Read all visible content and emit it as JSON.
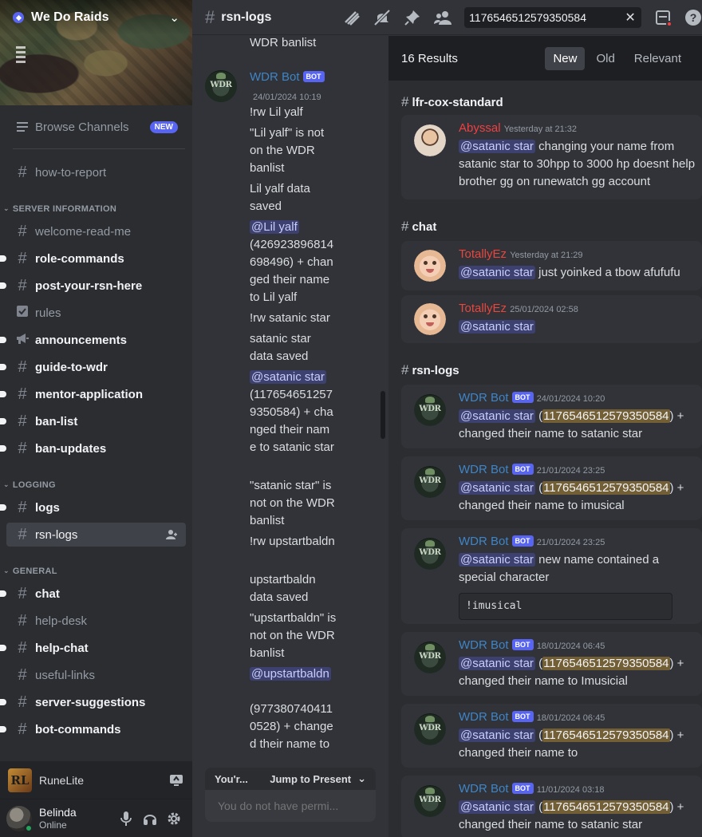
{
  "server": {
    "name": "We Do Raids"
  },
  "sidebar": {
    "browse_label": "Browse Channels",
    "new_badge": "NEW",
    "channels_top": [
      {
        "name": "how-to-report"
      }
    ],
    "categories": [
      {
        "label": "SERVER INFORMATION",
        "channels": [
          {
            "name": "welcome-read-me",
            "unread": false,
            "icon": "hash"
          },
          {
            "name": "role-commands",
            "unread": true,
            "icon": "hash"
          },
          {
            "name": "post-your-rsn-here",
            "unread": true,
            "icon": "hash"
          },
          {
            "name": "rules",
            "unread": false,
            "icon": "rules-checkbox"
          },
          {
            "name": "announcements",
            "unread": true,
            "icon": "megaphone"
          },
          {
            "name": "guide-to-wdr",
            "unread": true,
            "icon": "hash"
          },
          {
            "name": "mentor-application",
            "unread": true,
            "icon": "hash"
          },
          {
            "name": "ban-list",
            "unread": true,
            "icon": "hash"
          },
          {
            "name": "ban-updates",
            "unread": true,
            "icon": "hash"
          }
        ]
      },
      {
        "label": "LOGGING",
        "channels": [
          {
            "name": "logs",
            "unread": true,
            "icon": "hash"
          },
          {
            "name": "rsn-logs",
            "selected": true,
            "icon": "hash"
          }
        ]
      },
      {
        "label": "GENERAL",
        "channels": [
          {
            "name": "chat",
            "unread": true,
            "icon": "hash"
          },
          {
            "name": "help-desk",
            "unread": false,
            "icon": "hash"
          },
          {
            "name": "help-chat",
            "unread": true,
            "icon": "hash"
          },
          {
            "name": "useful-links",
            "unread": false,
            "icon": "hash"
          },
          {
            "name": "server-suggestions",
            "unread": true,
            "icon": "hash"
          },
          {
            "name": "bot-commands",
            "unread": true,
            "icon": "hash"
          }
        ]
      }
    ],
    "activity": {
      "label": "RuneLite",
      "logo_text": "RL"
    },
    "user": {
      "name": "Belinda",
      "status": "Online"
    }
  },
  "topbar": {
    "channel": "rsn-logs",
    "search_value": "1176546512579350584"
  },
  "channel_messages": {
    "top_line": "WDR banlist",
    "bot_name": "WDR Bot",
    "bot_tag": "BOT",
    "timestamp": "24/01/2024 10:19",
    "lines": [
      "!rw Lil yalf",
      "\"Lil yalf\" is not on the WDR banlist",
      "Lil yalf data saved"
    ],
    "mention1": "@Lil yalf",
    "after_mention1": "(426923896814698496) + changed their name to Lil yalf",
    "lines2": [
      "!rw satanic star",
      "satanic star data saved"
    ],
    "mention2": "@satanic star",
    "after_mention2": "(1176546512579350584) + changed their name to satanic star",
    "lines3": [
      "\"satanic star\" is not on the WDR banlist",
      "!rw upstartbaldn",
      "upstartbaldn data saved",
      "\"upstartbaldn\" is not on the WDR banlist"
    ],
    "mention3": "@upstartbaldn",
    "after_mention3": "(9773807404110528) + changed their name to",
    "jump_left": "You'r...",
    "jump_label": "Jump to Present",
    "composer_placeholder": "You do not have permi..."
  },
  "search_results": {
    "count_label": "16 Results",
    "sort_tabs": [
      "New",
      "Old",
      "Relevant"
    ],
    "active_sort": "New",
    "groups": [
      {
        "channel": "lfr-cox-standard"
      },
      {
        "channel": "chat"
      },
      {
        "channel": "rsn-logs"
      }
    ],
    "results": [
      {
        "author": "Abyssal",
        "time": "Yesterday at 21:32",
        "mention": "@satanic star",
        "text": " changing your name from satanic star to 30hpp to 3000 hp doesnt help brother gg on runewatch gg account"
      },
      {
        "author": "TotallyEz",
        "time": "Yesterday at 21:29",
        "mention": "@satanic star",
        "text": " just yoinked a tbow afufufu"
      },
      {
        "author": "TotallyEz",
        "time": "25/01/2024 02:58",
        "mention": "@satanic star",
        "text": ""
      },
      {
        "author": "WDR Bot",
        "bot": "BOT",
        "time": "24/01/2024 10:20",
        "mention": "@satanic star",
        "id": "1176546512579350584",
        "text": "changed their name to satanic star"
      },
      {
        "author": "WDR Bot",
        "bot": "BOT",
        "time": "21/01/2024 23:25",
        "mention": "@satanic star",
        "id": "1176546512579350584",
        "text": "changed their name to imusical"
      },
      {
        "author": "WDR Bot",
        "bot": "BOT",
        "time": "21/01/2024 23:25",
        "mention": "@satanic star",
        "text": " new name contained a special character",
        "code": "!imusical"
      },
      {
        "author": "WDR Bot",
        "bot": "BOT",
        "time": "18/01/2024 06:45",
        "mention": "@satanic star",
        "id": "1176546512579350584",
        "text": "changed their name to Imusicial"
      },
      {
        "author": "WDR Bot",
        "bot": "BOT",
        "time": "18/01/2024 06:45",
        "mention": "@satanic star",
        "id": "1176546512579350584",
        "text": "changed their name to"
      },
      {
        "author": "WDR Bot",
        "bot": "BOT",
        "time": "11/01/2024 03:18",
        "mention": "@satanic star",
        "id": "1176546512579350584",
        "text": "changed their name to satanic star"
      }
    ]
  },
  "colors": {
    "accent": "#5865f2",
    "bot_name": "#3e85c7",
    "red_author": "#f23f42",
    "highlight": "#f0b232",
    "online": "#23a55a"
  }
}
